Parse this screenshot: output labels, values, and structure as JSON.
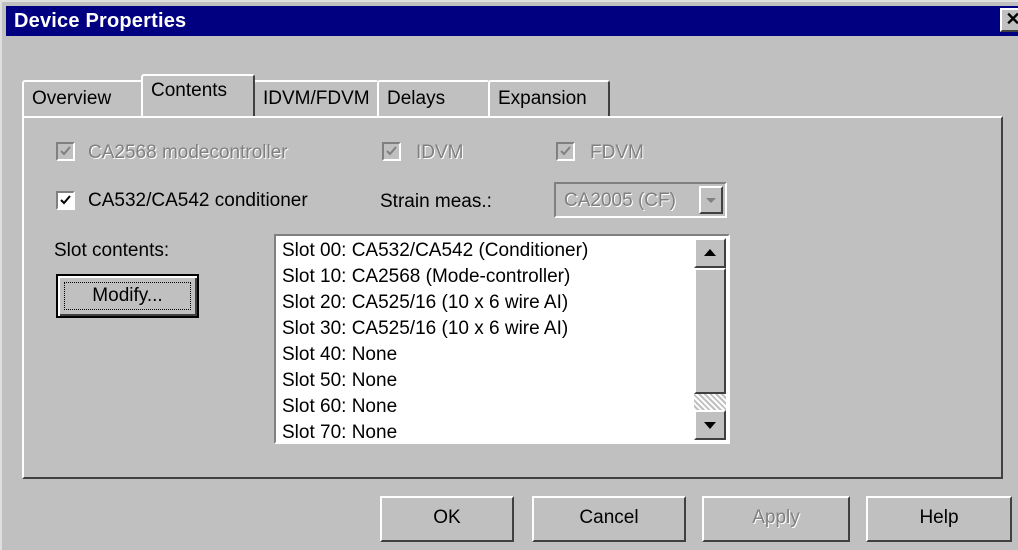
{
  "window": {
    "title": "Device Properties",
    "close_glyph": "✕"
  },
  "tabs": [
    {
      "label": "Overview",
      "active": false
    },
    {
      "label": "Contents",
      "active": true
    },
    {
      "label": "IDVM/FDVM",
      "active": false
    },
    {
      "label": "Delays",
      "active": false
    },
    {
      "label": "Expansion",
      "active": false
    }
  ],
  "contents": {
    "modecontroller": {
      "label": "CA2568 modecontroller",
      "checked": true,
      "enabled": false
    },
    "idvm": {
      "label": "IDVM",
      "checked": true,
      "enabled": false
    },
    "fdvm": {
      "label": "FDVM",
      "checked": true,
      "enabled": false
    },
    "conditioner": {
      "label": "CA532/CA542 conditioner",
      "checked": true,
      "enabled": true
    },
    "strain_label": "Strain meas.:",
    "strain_value": "CA2005 (CF)",
    "slot_label": "Slot contents:",
    "modify_label": "Modify...",
    "slots": [
      "Slot 00: CA532/CA542 (Conditioner)",
      "Slot 10: CA2568 (Mode-controller)",
      "Slot 20: CA525/16 (10 x 6 wire AI)",
      "Slot 30: CA525/16 (10 x 6 wire AI)",
      "Slot 40: None",
      "Slot 50: None",
      "Slot 60: None",
      "Slot 70: None"
    ]
  },
  "footer": {
    "ok": "OK",
    "cancel": "Cancel",
    "apply": "Apply",
    "help": "Help"
  },
  "colors": {
    "titlebar": "#000080",
    "face": "#c0c0c0"
  }
}
